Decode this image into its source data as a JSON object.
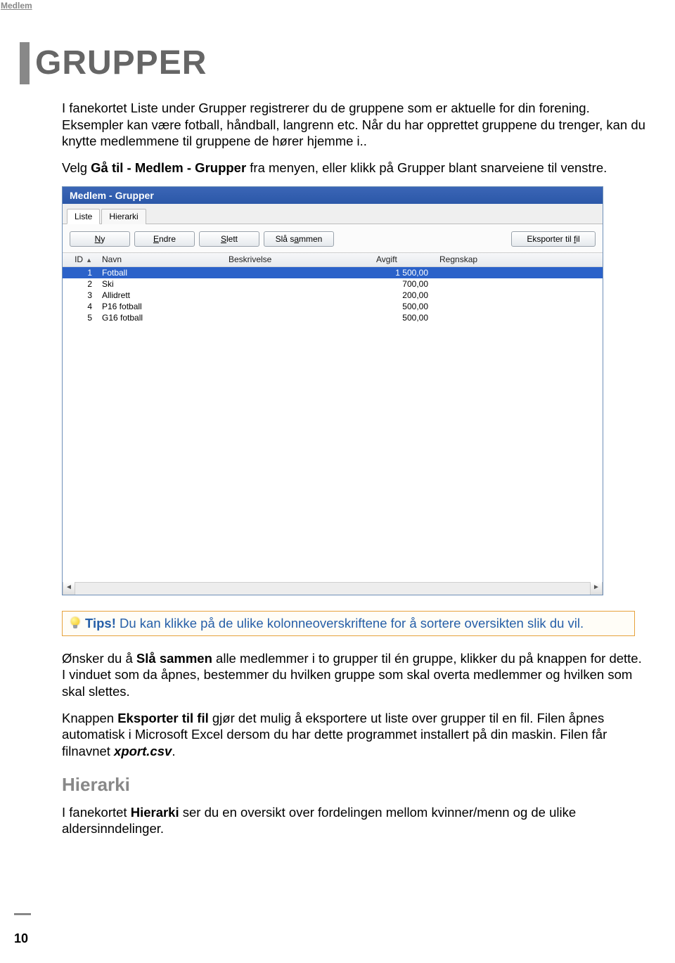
{
  "header_link": "Medlem",
  "title": "GRUPPER",
  "intro_html": "I fanekortet Liste under Grupper registrerer du de gruppene som er aktuelle for din forening. Eksempler kan være fotball, håndball, langrenn etc. Når du har opprettet gruppene du trenger, kan du knytte medlemmene til gruppene de hører hjemme i..",
  "hint_html": "Velg <b>Gå til - Medlem - Grupper</b> fra menyen, eller klikk på Grupper blant snarveiene til venstre.",
  "window": {
    "title": "Medlem - Grupper",
    "tabs": [
      "Liste",
      "Hierarki"
    ],
    "buttons": {
      "ny": "Ny",
      "endre": "Endre",
      "slett": "Slett",
      "sla_sammen": "Slå sammen",
      "eksporter": "Eksporter til fil"
    },
    "columns": {
      "id": "ID",
      "navn": "Navn",
      "beskrivelse": "Beskrivelse",
      "avgift": "Avgift",
      "regnskap": "Regnskap"
    },
    "rows": [
      {
        "id": "1",
        "navn": "Fotball",
        "beskrivelse": "",
        "avgift": "1 500,00",
        "regnskap": ""
      },
      {
        "id": "2",
        "navn": "Ski",
        "beskrivelse": "",
        "avgift": "700,00",
        "regnskap": ""
      },
      {
        "id": "3",
        "navn": "Allidrett",
        "beskrivelse": "",
        "avgift": "200,00",
        "regnskap": ""
      },
      {
        "id": "4",
        "navn": "P16 fotball",
        "beskrivelse": "",
        "avgift": "500,00",
        "regnskap": ""
      },
      {
        "id": "5",
        "navn": "G16 fotball",
        "beskrivelse": "",
        "avgift": "500,00",
        "regnskap": ""
      }
    ]
  },
  "tip_label": "Tips!",
  "tip_text": "Du kan klikke på de ulike kolonneoverskriftene for å sortere oversikten slik du vil.",
  "para2_html": "Ønsker du å <b>Slå sammen</b> alle medlemmer i to grupper til én gruppe, klikker du på knappen for dette. I vinduet som da åpnes, bestemmer du hvilken gruppe som skal overta medlemmer og hvilken som skal slettes.",
  "para3_html": "Knappen <b>Eksporter til fil</b> gjør det mulig å eksportere ut liste over grupper til en fil. Filen åpnes automatisk i Microsoft Excel dersom du har dette programmet installert på din maskin. Filen får filnavnet <i><b>xport.csv</b></i>.",
  "sub_heading": "Hierarki",
  "para4_html": "I fanekortet <b>Hierarki</b> ser du en oversikt over fordelingen mellom kvinner/menn og de ulike aldersinndelinger.",
  "page_number": "10"
}
